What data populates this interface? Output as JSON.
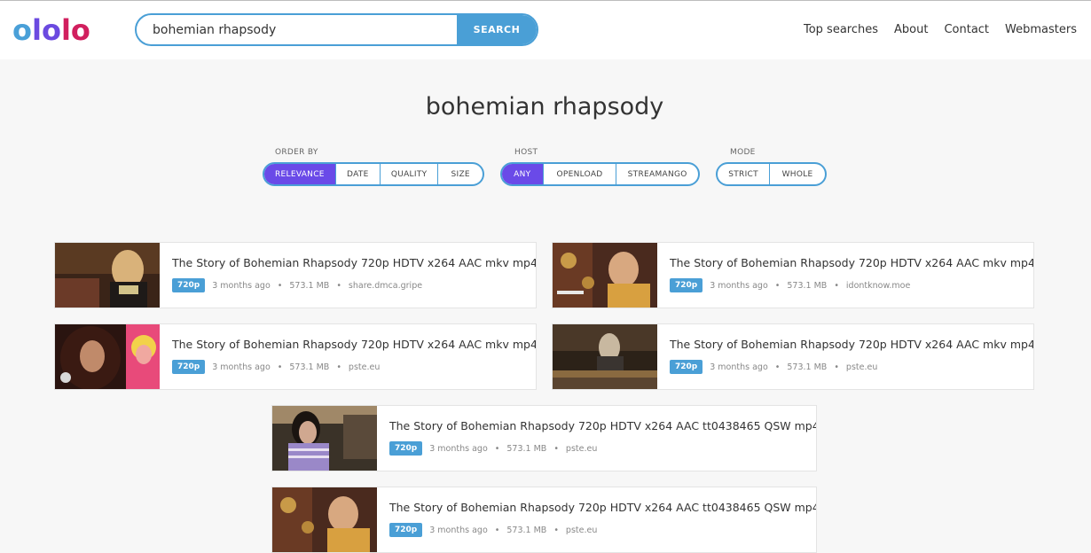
{
  "header": {
    "logo_letters": [
      "o",
      "l",
      "o",
      "l",
      "o"
    ],
    "logo_colors": [
      "#4aa0d8",
      "#6b4ae0",
      "#6b4ae0",
      "#d11f5e",
      "#d11f5e"
    ],
    "search_value": "bohemian rhapsody",
    "search_button": "SEARCH",
    "nav": [
      "Top searches",
      "About",
      "Contact",
      "Webmasters"
    ]
  },
  "query_title": "bohemian rhapsody",
  "filters": {
    "order_by": {
      "label": "ORDER BY",
      "options": [
        "RELEVANCE",
        "DATE",
        "QUALITY",
        "SIZE"
      ],
      "active": "RELEVANCE"
    },
    "host": {
      "label": "HOST",
      "options": [
        "ANY",
        "OPENLOAD",
        "STREAMANGO"
      ],
      "active": "ANY"
    },
    "mode": {
      "label": "MODE",
      "options": [
        "STRICT",
        "WHOLE"
      ],
      "active": ""
    }
  },
  "results": [
    {
      "title": "The Story of Bohemian Rhapsody 720p HDTV x264 AAC mkv mp4",
      "quality": "720p",
      "age": "3 months ago",
      "size": "573.1 MB",
      "host": "share.dmca.gripe"
    },
    {
      "title": "The Story of Bohemian Rhapsody 720p HDTV x264 AAC mkv mp4",
      "quality": "720p",
      "age": "3 months ago",
      "size": "573.1 MB",
      "host": "idontknow.moe"
    },
    {
      "title": "The Story of Bohemian Rhapsody 720p HDTV x264 AAC mkv mp4",
      "quality": "720p",
      "age": "3 months ago",
      "size": "573.1 MB",
      "host": "pste.eu"
    },
    {
      "title": "The Story of Bohemian Rhapsody 720p HDTV x264 AAC mkv mp4",
      "quality": "720p",
      "age": "3 months ago",
      "size": "573.1 MB",
      "host": "pste.eu"
    },
    {
      "title": "The Story of Bohemian Rhapsody 720p HDTV x264 AAC tt0438465 QSW mp4",
      "quality": "720p",
      "age": "3 months ago",
      "size": "573.1 MB",
      "host": "pste.eu"
    },
    {
      "title": "The Story of Bohemian Rhapsody 720p HDTV x264 AAC tt0438465 QSW mp4",
      "quality": "720p",
      "age": "3 months ago",
      "size": "573.1 MB",
      "host": "pste.eu"
    }
  ],
  "meta_separator": "•"
}
